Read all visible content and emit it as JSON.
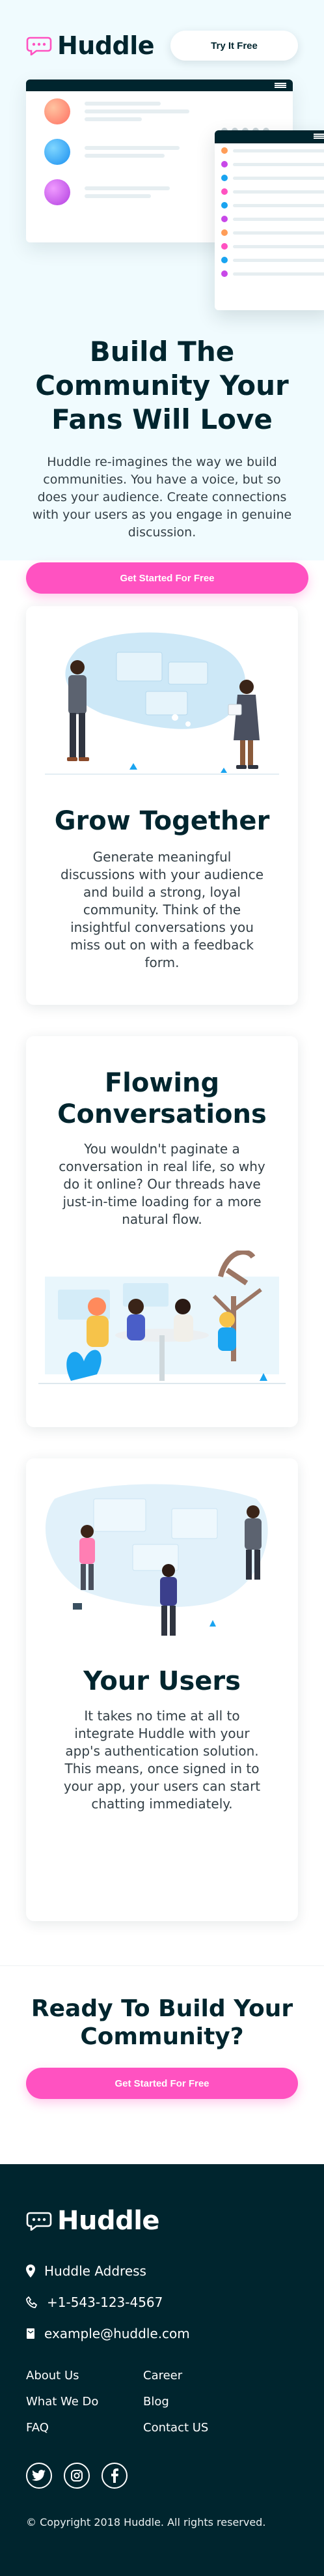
{
  "header": {
    "logo_text": "Huddle",
    "try_button": "Try It Free"
  },
  "hero": {
    "title": "Build The Community Your Fans Will Love",
    "text": "Huddle re-imagines the way we build communities. You have a voice, but so does your audience. Create connections with your users as you engage in genuine discussion.",
    "cta_button": "Get Started For Free"
  },
  "features": [
    {
      "title": "Grow Together",
      "text": "Generate meaningful discussions with your audience and build a strong, loyal community. Think of the insightful conversations you miss out on with a feedback form."
    },
    {
      "title": "Flowing Conversations",
      "text": "You wouldn't paginate a conversation in real life, so why do it online? Our threads have just-in-time loading for a more natural flow."
    },
    {
      "title": "Your Users",
      "text": "It takes no time at all to integrate Huddle with your app's authentication solution. This means, once signed in to your app, your users can start chatting immediately."
    }
  ],
  "cta": {
    "title": "Ready To Build Your Community?",
    "button": "Get Started For Free"
  },
  "footer": {
    "logo_text": "Huddle",
    "address": "Huddle Address",
    "phone": "+1-543-123-4567",
    "email": "example@huddle.com",
    "links": [
      "About Us",
      "Career",
      "What We Do",
      "Blog",
      "FAQ",
      "Contact US"
    ],
    "social_icons": [
      "twitter-icon",
      "instagram-icon",
      "facebook-icon"
    ],
    "copyright": "© Copyright 2018 Huddle. All rights reserved."
  },
  "colors": {
    "navy": "#00252e",
    "pink": "#ff52c1",
    "hero_bg": "#f0fbfe",
    "avatar_orange": "#ff9d58",
    "avatar_blue": "#1aa4f0",
    "avatar_purple": "#c848e8"
  }
}
